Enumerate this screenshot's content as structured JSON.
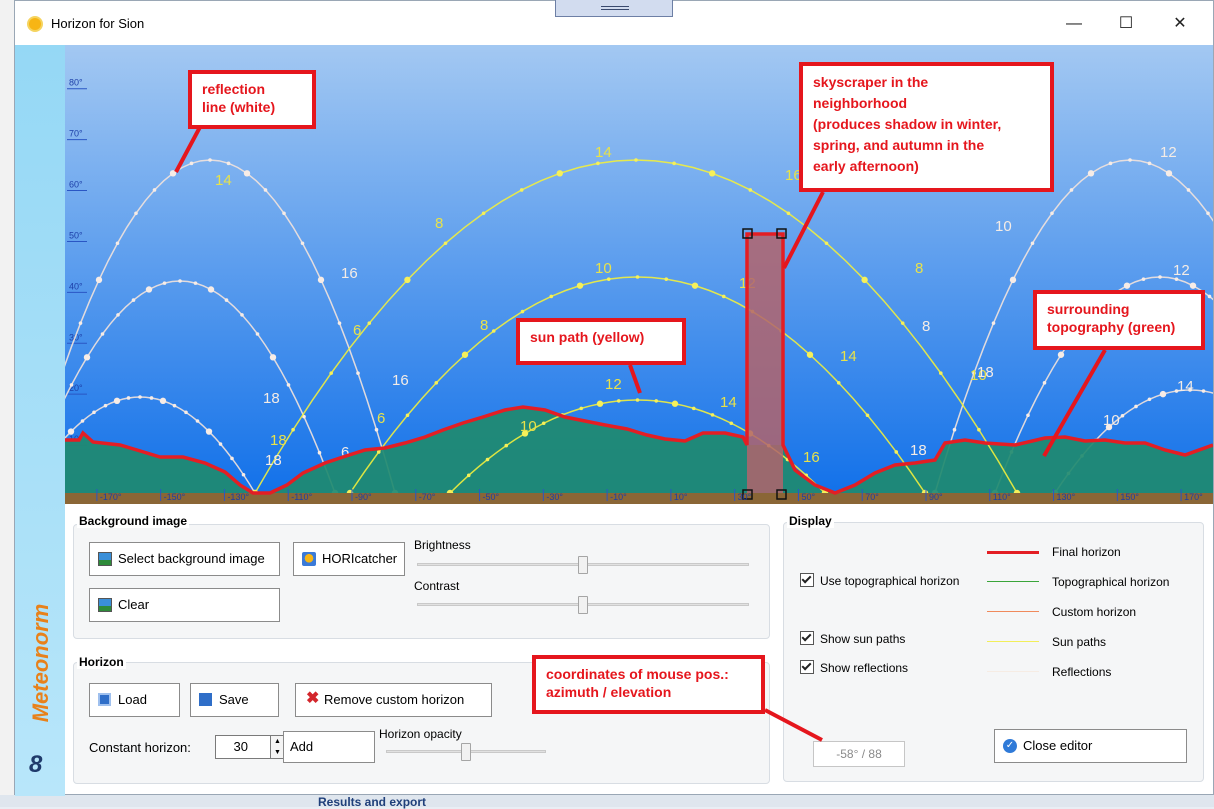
{
  "window": {
    "title": "Horizon for Sion",
    "minimize": "—",
    "maximize": "☐",
    "close": "✕"
  },
  "sidebar": {
    "brand": "Meteonorm",
    "version": "8"
  },
  "chart": {
    "elev_ticks": [
      "10°",
      "20°",
      "30°",
      "40°",
      "50°",
      "60°",
      "70°",
      "80°"
    ],
    "az_ticks": [
      "-170°",
      "-150°",
      "-130°",
      "-110°",
      "-90°",
      "-70°",
      "-50°",
      "-30°",
      "-10°",
      "10°",
      "30°",
      "50°",
      "70°",
      "90°",
      "110°",
      "130°",
      "150°",
      "170°"
    ],
    "hour_labels": [
      "6",
      "8",
      "10",
      "12",
      "14",
      "16",
      "18"
    ]
  },
  "background_image": {
    "title": "Background image",
    "select_btn": "Select background image",
    "horicatcher_btn": "HORIcatcher",
    "clear_btn": "Clear",
    "brightness_label": "Brightness",
    "brightness_value": 0.5,
    "contrast_label": "Contrast",
    "contrast_value": 0.5
  },
  "horizon": {
    "title": "Horizon",
    "load_btn": "Load",
    "save_btn": "Save",
    "remove_btn": "Remove custom horizon",
    "constant_label": "Constant horizon:",
    "constant_value": "30",
    "unit": "°",
    "add_btn": "Add",
    "opacity_label": "Horizon opacity",
    "opacity_value": 0.5
  },
  "display": {
    "title": "Display",
    "use_topo": "Use topographical horizon",
    "show_sun": "Show sun paths",
    "show_refl": "Show reflections",
    "legend": [
      {
        "label": "Final horizon",
        "color": "#e31e24"
      },
      {
        "label": "Topographical horizon",
        "color": "#3aa53a"
      },
      {
        "label": "Custom horizon",
        "color": "#f08a5c"
      },
      {
        "label": "Sun paths",
        "color": "#f2ef5a"
      },
      {
        "label": "Reflections",
        "color": "#f6ece4"
      }
    ],
    "coords": "-58° / 88",
    "close_btn": "Close editor"
  },
  "annotations": {
    "reflection": "reflection\nline (white)",
    "skyscraper": "skyscraper in the\nneighborhood\n(produces shadow in winter,\nspring, and autumn in the\nearly afternoon)",
    "sunpath": "sun path (yellow)",
    "topography": "surrounding\ntopography (green)",
    "coordinates": "coordinates of mouse pos.:\nazimuth / elevation"
  },
  "colors": {
    "final": "#e31e24",
    "topo_fill": "#1f8a6f",
    "sky_top": "#9cc4f2",
    "sky_bottom": "#1272e9",
    "ground": "#8a6636",
    "sun": "#f2ef3c",
    "reflection": "#f5e4dc"
  },
  "background": {
    "footer_text": "Results and export"
  }
}
